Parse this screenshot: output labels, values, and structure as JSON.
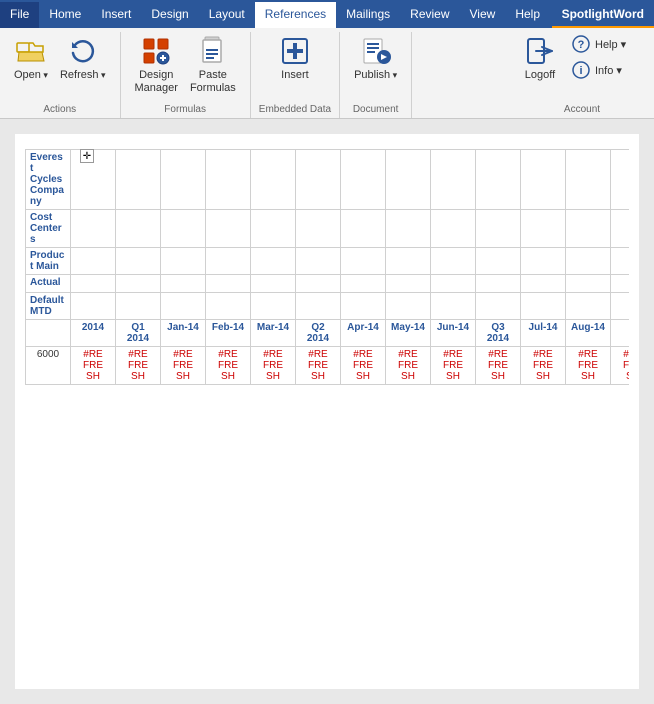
{
  "ribbon": {
    "tabs": [
      {
        "label": "File",
        "active": false
      },
      {
        "label": "Home",
        "active": false
      },
      {
        "label": "Insert",
        "active": false
      },
      {
        "label": "Design",
        "active": false
      },
      {
        "label": "Layout",
        "active": false
      },
      {
        "label": "References",
        "active": true
      },
      {
        "label": "Mailings",
        "active": false
      },
      {
        "label": "Review",
        "active": false
      },
      {
        "label": "View",
        "active": false
      },
      {
        "label": "Help",
        "active": false
      },
      {
        "label": "SpotlightWord",
        "active": false,
        "spotlight": true
      }
    ],
    "groups": {
      "actions": {
        "label": "Actions",
        "buttons": [
          {
            "label": "Open",
            "arrow": true,
            "id": "open"
          },
          {
            "label": "Refresh",
            "arrow": true,
            "id": "refresh"
          }
        ]
      },
      "formulas": {
        "label": "Formulas",
        "buttons": [
          {
            "label": "Design\nManager",
            "id": "design-manager"
          },
          {
            "label": "Paste\nFormulas",
            "id": "paste-formulas"
          }
        ]
      },
      "embedded": {
        "label": "Embedded Data",
        "buttons": [
          {
            "label": "Insert",
            "id": "insert"
          }
        ]
      },
      "document": {
        "label": "Document",
        "buttons": [
          {
            "label": "Publish",
            "arrow": true,
            "id": "publish"
          }
        ]
      },
      "account": {
        "label": "Account",
        "buttons": [
          {
            "label": "Logoff",
            "id": "logoff"
          },
          {
            "label": "Help",
            "arrow": true,
            "id": "help"
          },
          {
            "label": "Info",
            "arrow": true,
            "id": "info"
          }
        ]
      }
    }
  },
  "table": {
    "row_headers": [
      {
        "id": "company",
        "label": "Everest Cycles Company"
      },
      {
        "id": "cost-centers",
        "label": "Cost Centers"
      },
      {
        "id": "product-main",
        "label": "Product Main"
      },
      {
        "id": "actual",
        "label": "Actual"
      },
      {
        "id": "default-mtd",
        "label": "Default MTD"
      }
    ],
    "col_headers": [
      "",
      "2014",
      "Q1 2014",
      "Jan-14",
      "Feb-14",
      "Mar-14",
      "Q2 2014",
      "Apr-14",
      "May-14",
      "Jun-14",
      "Q3 2014",
      "Jul-14",
      "Aug-14",
      ""
    ],
    "data_row": {
      "id": "6000",
      "value": "#REFRESH"
    }
  }
}
